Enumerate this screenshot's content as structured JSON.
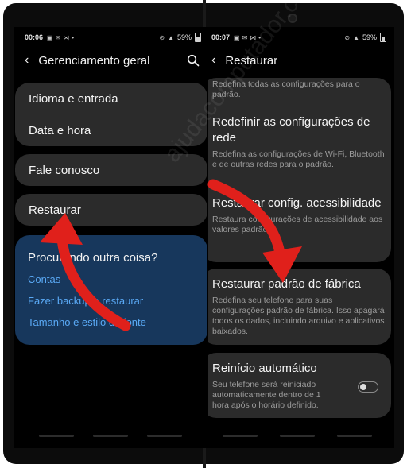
{
  "left_screen": {
    "status": {
      "time": "00:06",
      "battery": "59%"
    },
    "header": {
      "title": "Gerenciamento geral"
    },
    "menu": {
      "idioma": "Idioma e entrada",
      "data_hora": "Data e hora",
      "fale": "Fale conosco",
      "restaurar": "Restaurar"
    },
    "suggestions": {
      "heading": "Procurando outra coisa?",
      "links": [
        "Contas",
        "Fazer backup e restaurar",
        "Tamanho e estilo da fonte"
      ]
    }
  },
  "right_screen": {
    "status": {
      "time": "00:07",
      "battery": "59%"
    },
    "header": {
      "title": "Restaurar"
    },
    "items": [
      {
        "title": "",
        "desc": "Redefina todas as configurações para o padrão."
      },
      {
        "title": "Redefinir as configurações de rede",
        "desc": "Redefina as configurações de Wi-Fi, Bluetooth e de outras redes para o padrão."
      },
      {
        "title": "Restaurar config. acessibilidade",
        "desc": "Restaura configurações de acessibilidade aos valores padrão."
      },
      {
        "title": "Restaurar padrão de fábrica",
        "desc": "Redefina seu telefone para suas configurações padrão de fábrica. Isso apagará todos os dados, incluindo arquivo e aplicativos baixados."
      },
      {
        "title": "Reinício automático",
        "desc": "Seu telefone será reiniciado automaticamente dentro de 1 hora após o horário definido."
      }
    ],
    "auto_restart_enabled": false
  },
  "watermark": "ajudacomputador.com",
  "colors": {
    "accent_link": "#5aa9f5",
    "arrow": "#e0201b",
    "suggest_bg": "#17375c",
    "card_bg": "#2b2b2b"
  }
}
